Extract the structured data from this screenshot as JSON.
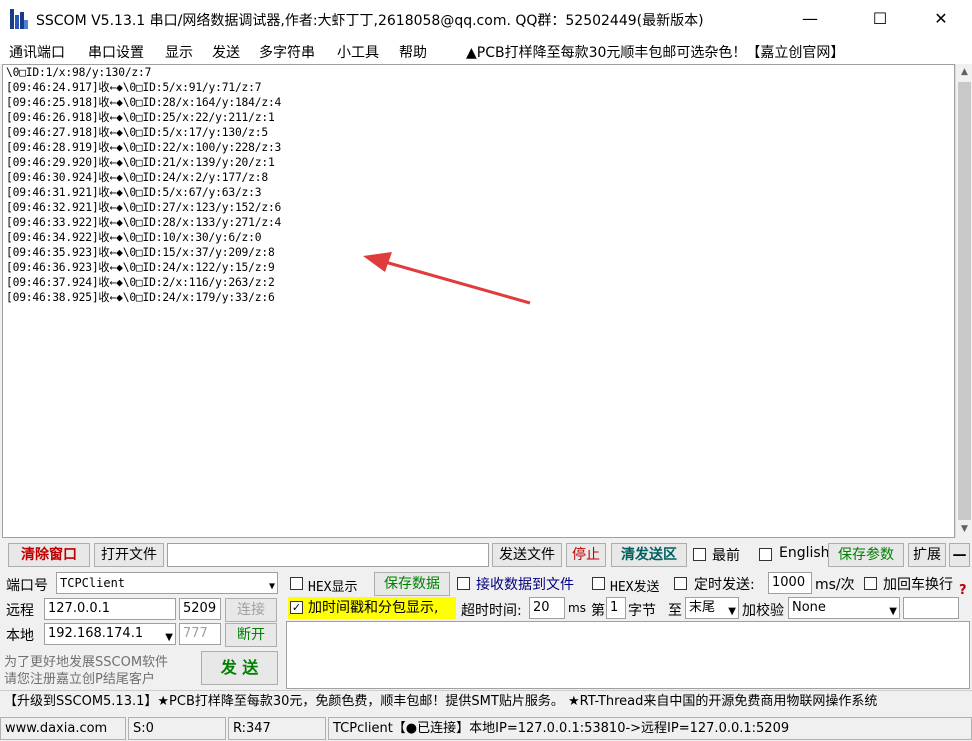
{
  "window": {
    "title": "SSCOM V5.13.1 串口/网络数据调试器,作者:大虾丁丁,2618058@qq.com. QQ群：52502449(最新版本)",
    "minimize": "—",
    "maximize": "☐",
    "close": "✕"
  },
  "menu": {
    "items": [
      "通讯端口",
      "串口设置",
      "显示",
      "发送",
      "多字符串",
      "小工具",
      "帮助"
    ],
    "promo": "▲PCB打样降至每款30元顺丰包邮可选杂色！【嘉立创官网】"
  },
  "receive": {
    "lines": [
      "\\0□ID:1/x:98/y:130/z:7",
      "[09:46:24.917]收←◆\\0□ID:5/x:91/y:71/z:7",
      "[09:46:25.918]收←◆\\0□ID:28/x:164/y:184/z:4",
      "[09:46:26.918]收←◆\\0□ID:25/x:22/y:211/z:1",
      "[09:46:27.918]收←◆\\0□ID:5/x:17/y:130/z:5",
      "[09:46:28.919]收←◆\\0□ID:22/x:100/y:228/z:3",
      "[09:46:29.920]收←◆\\0□ID:21/x:139/y:20/z:1",
      "[09:46:30.924]收←◆\\0□ID:24/x:2/y:177/z:8",
      "[09:46:31.921]收←◆\\0□ID:5/x:67/y:63/z:3",
      "[09:46:32.921]收←◆\\0□ID:27/x:123/y:152/z:6",
      "[09:46:33.922]收←◆\\0□ID:28/x:133/y:271/z:4",
      "[09:46:34.922]收←◆\\0□ID:10/x:30/y:6/z:0",
      "[09:46:35.923]收←◆\\0□ID:15/x:37/y:209/z:8",
      "[09:46:36.923]收←◆\\0□ID:24/x:122/y:15/z:9",
      "[09:46:37.924]收←◆\\0□ID:2/x:116/y:263/z:2",
      "[09:46:38.925]收←◆\\0□ID:24/x:179/y:33/z:6"
    ]
  },
  "toolbar": {
    "clear": "清除窗口",
    "open_file": "打开文件",
    "send_file": "发送文件",
    "stop": "停止",
    "clear_send": "清发送区",
    "topmost": "最前",
    "english": "English",
    "save_params": "保存参数",
    "expand": "扩展",
    "collapse": "—"
  },
  "connection": {
    "port_label": "端口号",
    "port_value": "TCPClient",
    "remote_label": "远程",
    "remote_ip": "127.0.0.1",
    "remote_port": "5209",
    "connect": "连接",
    "local_label": "本地",
    "local_ip": "192.168.174.1",
    "local_port": "777",
    "disconnect": "断开",
    "ad_line1": "为了更好地发展SSCOM软件",
    "ad_line2": "请您注册嘉立创P结尾客户",
    "send": "发 送"
  },
  "options": {
    "hex_display": "HEX显示",
    "save_data": "保存数据",
    "recv_to_file": "接收数据到文件",
    "hex_send": "HEX发送",
    "timed_send": "定时发送:",
    "interval": "1000",
    "interval_unit": "ms/次",
    "add_newline": "加回车换行",
    "timestamp": "加时间戳和分包显示,",
    "timeout_label": "超时时间:",
    "timeout_value": "20",
    "timeout_unit": "ms",
    "byte_label_1": "第",
    "byte_value": "1",
    "byte_label_2": "字节",
    "to_label": "至",
    "end_value": "末尾",
    "checksum_label": "加校验",
    "checksum_value": "None",
    "help_mark": "?"
  },
  "banner": {
    "text": "【升级到SSCOM5.13.1】★PCB打样降至每款30元，免颜色费，顺丰包邮！提供SMT贴片服务。 ★RT-Thread来自中国的开源免费商用物联网操作系统"
  },
  "status": {
    "website": "www.daxia.com",
    "sent": "S:0",
    "received": "R:347",
    "connection": "TCPclient【●已连接】本地IP=127.0.0.1:53810->远程IP=127.0.0.1:5209"
  },
  "colors": {
    "accent_red": "#c00000",
    "accent_green": "#008000",
    "annotation_arrow": "#e03c3c",
    "highlight_yellow": "#ffff00"
  }
}
